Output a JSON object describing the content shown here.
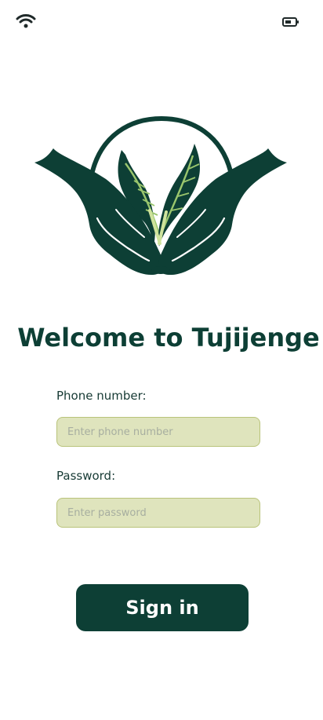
{
  "status_bar": {
    "wifi_icon": "wifi-icon",
    "battery_icon": "battery-icon"
  },
  "logo": {
    "icon": "hands-holding-leaves-logo",
    "colors": {
      "dark_green": "#0d3f35",
      "leaf_highlight": "#9ac66d"
    }
  },
  "welcome": {
    "title": "Welcome to Tujijenge"
  },
  "form": {
    "phone_label": "Phone number:",
    "phone_placeholder": "Enter phone number",
    "phone_value": "",
    "password_label": "Password:",
    "password_placeholder": "Enter password",
    "password_value": ""
  },
  "actions": {
    "sign_in_label": "Sign in"
  },
  "colors": {
    "primary": "#0d3f35",
    "input_background": "#dfe4bd",
    "input_border": "#b9c37a"
  }
}
